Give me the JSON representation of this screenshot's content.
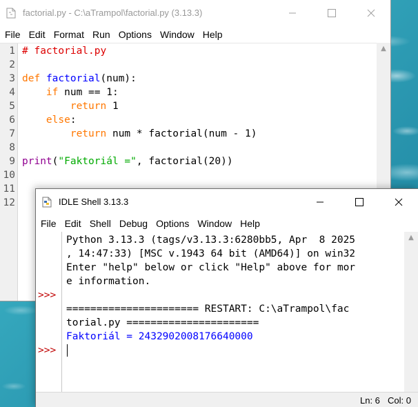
{
  "editor": {
    "title": "factorial.py - C:\\aTrampol\\factorial.py (3.13.3)",
    "menu": [
      "File",
      "Edit",
      "Format",
      "Run",
      "Options",
      "Window",
      "Help"
    ],
    "line_numbers": [
      "1",
      "2",
      "3",
      "4",
      "5",
      "6",
      "7",
      "8",
      "9",
      "10",
      "11",
      "12"
    ],
    "code": {
      "l1": "# factorial.py",
      "l3_kw": "def",
      "l3_name": "factorial",
      "l3_rest": "(num):",
      "l4_kw": "if",
      "l4_rest": " num == 1:",
      "l5_kw": "return",
      "l5_rest": " 1",
      "l6_kw": "else",
      "l6_rest": ":",
      "l7_kw": "return",
      "l7_rest": " num * factorial(num - 1)",
      "l9_builtin": "print",
      "l9_open": "(",
      "l9_str": "\"Faktoriál =\"",
      "l9_rest": ", factorial(20))"
    }
  },
  "shell": {
    "title": "IDLE Shell 3.13.3",
    "menu": [
      "File",
      "Edit",
      "Shell",
      "Debug",
      "Options",
      "Window",
      "Help"
    ],
    "prompt": ">>>",
    "lines": [
      "Python 3.13.3 (tags/v3.13.3:6280bb5, Apr  8 2025",
      ", 14:47:33) [MSC v.1943 64 bit (AMD64)] on win32",
      "Enter \"help\" below or click \"Help\" above for mor",
      "e information.",
      "",
      "====================== RESTART: C:\\aTrampol\\fac",
      "torial.py ======================",
      "Faktoriál = 2432902008176640000"
    ],
    "status": {
      "line": "Ln: 6",
      "col": "Col: 0"
    }
  },
  "colors": {
    "comment": "#dd0000",
    "keyword": "#ff7700",
    "definition": "#0000ff",
    "builtin": "#900090",
    "string": "#00aa00",
    "stdout": "#0000ff",
    "prompt": "#c00000"
  },
  "icons": [
    "python-file-icon",
    "minimize-icon",
    "maximize-icon",
    "close-icon",
    "scroll-up-arrow-icon"
  ]
}
